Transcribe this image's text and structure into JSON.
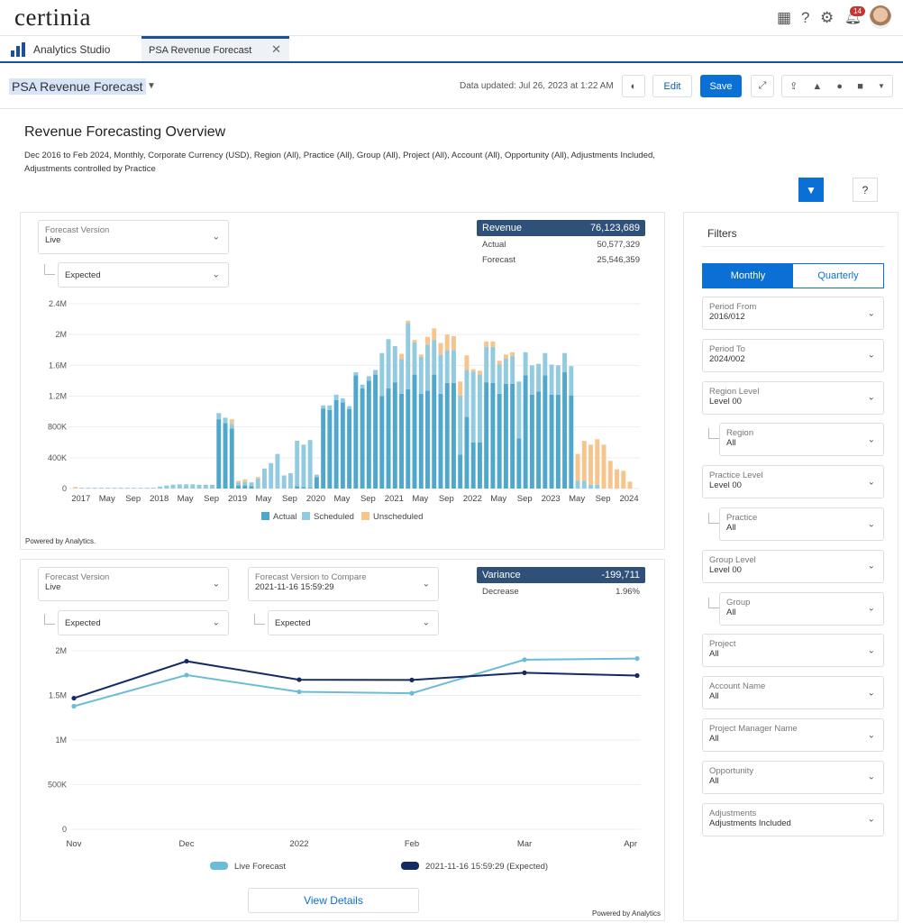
{
  "header": {
    "logo": "certinia",
    "notifications": "14",
    "icons": [
      "app-launcher-icon",
      "help-icon",
      "gear-icon",
      "bell-icon"
    ]
  },
  "tabs": [
    {
      "label": "Analytics Studio"
    },
    {
      "label": "PSA Revenue Forecast"
    }
  ],
  "toolbar": {
    "dashboard_name": "PSA Revenue Forecast",
    "updated": "Data updated: Jul 26, 2023 at 1:22 AM",
    "edit": "Edit",
    "save": "Save"
  },
  "page": {
    "title": "Revenue Forecasting Overview",
    "subtitle": "Dec 2016 to Feb 2024, Monthly, Corporate Currency (USD), Region (All), Practice (All), Group (All), Project (All), Account (All), Opportunity (All), Adjustments Included, Adjustments controlled by Practice",
    "help": "?"
  },
  "card1": {
    "forecast_version_label": "Forecast Version",
    "forecast_version": "Live",
    "sub_select": "Expected",
    "kpi": {
      "title": "Revenue",
      "value": "76,123,689",
      "actual_label": "Actual",
      "actual": "50,577,329",
      "forecast_label": "Forecast",
      "forecast": "25,546,359"
    },
    "powered": "Powered by Analytics."
  },
  "card2": {
    "forecast_version_label": "Forecast Version",
    "forecast_version": "Live",
    "sub_select": "Expected",
    "compare_label": "Forecast Version to Compare",
    "compare_value": "2021-11-16 15:59:29",
    "compare_sub": "Expected",
    "kpi": {
      "title": "Variance",
      "value": "-199,711",
      "change_label": "Decrease",
      "change": "1.96%"
    },
    "view_details": "View Details",
    "powered": "Powered by Analytics"
  },
  "filters": {
    "title": "Filters",
    "monthly": "Monthly",
    "quarterly": "Quarterly",
    "items": [
      {
        "label": "Period From",
        "value": "2016/012",
        "child": false
      },
      {
        "label": "Period To",
        "value": "2024/002",
        "child": false
      },
      {
        "label": "Region Level",
        "value": "Level 00",
        "child": false
      },
      {
        "label": "Region",
        "value": "All",
        "child": true
      },
      {
        "label": "Practice Level",
        "value": "Level 00",
        "child": false
      },
      {
        "label": "Practice",
        "value": "All",
        "child": true
      },
      {
        "label": "Group Level",
        "value": "Level 00",
        "child": false
      },
      {
        "label": "Group",
        "value": "All",
        "child": true
      },
      {
        "label": "Project",
        "value": "All",
        "child": false
      },
      {
        "label": "Account Name",
        "value": "All",
        "child": false
      },
      {
        "label": "Project Manager Name",
        "value": "All",
        "child": false
      },
      {
        "label": "Opportunity",
        "value": "All",
        "child": false
      },
      {
        "label": "Adjustments",
        "value": "Adjustments Included",
        "child": false
      }
    ]
  },
  "chart_data": [
    {
      "type": "bar",
      "stacked": true,
      "x_start": "Dec 2016",
      "x_end": "Feb 2024",
      "interval": "monthly",
      "x_ticks": [
        "2017",
        "May",
        "Sep",
        "2018",
        "May",
        "Sep",
        "2019",
        "May",
        "Sep",
        "2020",
        "May",
        "Sep",
        "2021",
        "May",
        "Sep",
        "2022",
        "May",
        "Sep",
        "2023",
        "May",
        "Sep",
        "2024"
      ],
      "y_ticks": [
        "0",
        "400K",
        "800K",
        "1.2M",
        "1.6M",
        "2M",
        "2.4M"
      ],
      "ylim": [
        0,
        2400000
      ],
      "grid": true,
      "legend": "bottom",
      "series": [
        {
          "name": "Actual",
          "color": "#4fa7cb",
          "values": [
            0,
            0,
            0,
            0,
            0,
            0,
            0,
            0,
            0,
            0,
            0,
            0,
            0,
            0,
            0,
            0,
            0,
            0,
            0,
            0,
            0,
            0,
            900000,
            850000,
            780000,
            40000,
            40000,
            30000,
            0,
            0,
            0,
            0,
            0,
            0,
            30000,
            20000,
            10000,
            150000,
            1040000,
            1020000,
            1150000,
            1120000,
            1030000,
            1470000,
            1300000,
            1400000,
            1480000,
            1200000,
            1300000,
            1380000,
            1230000,
            1290000,
            1480000,
            1230000,
            1270000,
            1480000,
            1230000,
            1370000,
            1370000,
            440000,
            930000,
            600000,
            600000,
            1380000,
            1370000,
            1230000,
            1360000,
            1360000,
            650000,
            1470000,
            1220000,
            1260000,
            1470000,
            1220000,
            1220000,
            1510000,
            1210000,
            0,
            0,
            0,
            0,
            0,
            0,
            0,
            0,
            0,
            0
          ]
        },
        {
          "name": "Scheduled",
          "color": "#92cbe0",
          "values": [
            0,
            10000,
            10000,
            10000,
            10000,
            10000,
            10000,
            10000,
            10000,
            10000,
            10000,
            10000,
            10000,
            25000,
            40000,
            50000,
            55000,
            55000,
            55000,
            50000,
            50000,
            50000,
            80000,
            70000,
            60000,
            40000,
            50000,
            50000,
            130000,
            260000,
            330000,
            450000,
            170000,
            200000,
            590000,
            550000,
            620000,
            30000,
            40000,
            60000,
            70000,
            50000,
            40000,
            40000,
            50000,
            60000,
            60000,
            560000,
            640000,
            470000,
            450000,
            860000,
            420000,
            480000,
            600000,
            450000,
            510000,
            430000,
            430000,
            770000,
            610000,
            920000,
            880000,
            460000,
            470000,
            380000,
            330000,
            360000,
            740000,
            300000,
            380000,
            360000,
            290000,
            390000,
            380000,
            250000,
            380000,
            100000,
            100000,
            50000,
            50000,
            0,
            0,
            0,
            0,
            0,
            0
          ]
        },
        {
          "name": "Unscheduled",
          "color": "#f7c48c",
          "values": [
            20000,
            0,
            0,
            0,
            0,
            0,
            0,
            0,
            0,
            0,
            0,
            0,
            0,
            0,
            0,
            0,
            0,
            0,
            0,
            0,
            0,
            0,
            0,
            0,
            60000,
            20000,
            30000,
            0,
            20000,
            0,
            0,
            0,
            0,
            0,
            0,
            0,
            0,
            0,
            0,
            0,
            0,
            0,
            0,
            0,
            0,
            0,
            0,
            0,
            0,
            0,
            70000,
            30000,
            30000,
            30000,
            100000,
            150000,
            150000,
            200000,
            180000,
            180000,
            190000,
            30000,
            50000,
            70000,
            70000,
            50000,
            50000,
            50000,
            0,
            0,
            0,
            0,
            0,
            0,
            0,
            0,
            0,
            350000,
            520000,
            520000,
            590000,
            570000,
            360000,
            250000,
            230000,
            90000,
            0
          ]
        }
      ]
    },
    {
      "type": "line",
      "categories": [
        "Nov",
        "Dec",
        "2022",
        "Feb",
        "Mar",
        "Apr"
      ],
      "y_ticks": [
        "0",
        "500K",
        "1M",
        "1.5M",
        "2M"
      ],
      "ylim": [
        0,
        2000000
      ],
      "grid": true,
      "legend": "bottom",
      "series": [
        {
          "name": "Live Forecast",
          "color": "#6bbcd6",
          "values": [
            1379000,
            1728000,
            1540000,
            1524000,
            1900000,
            1913000
          ]
        },
        {
          "name": "2021-11-16 15:59:29 (Expected)",
          "color": "#152a62",
          "values": [
            1469000,
            1883000,
            1676000,
            1673000,
            1754000,
            1722000
          ]
        }
      ]
    }
  ]
}
